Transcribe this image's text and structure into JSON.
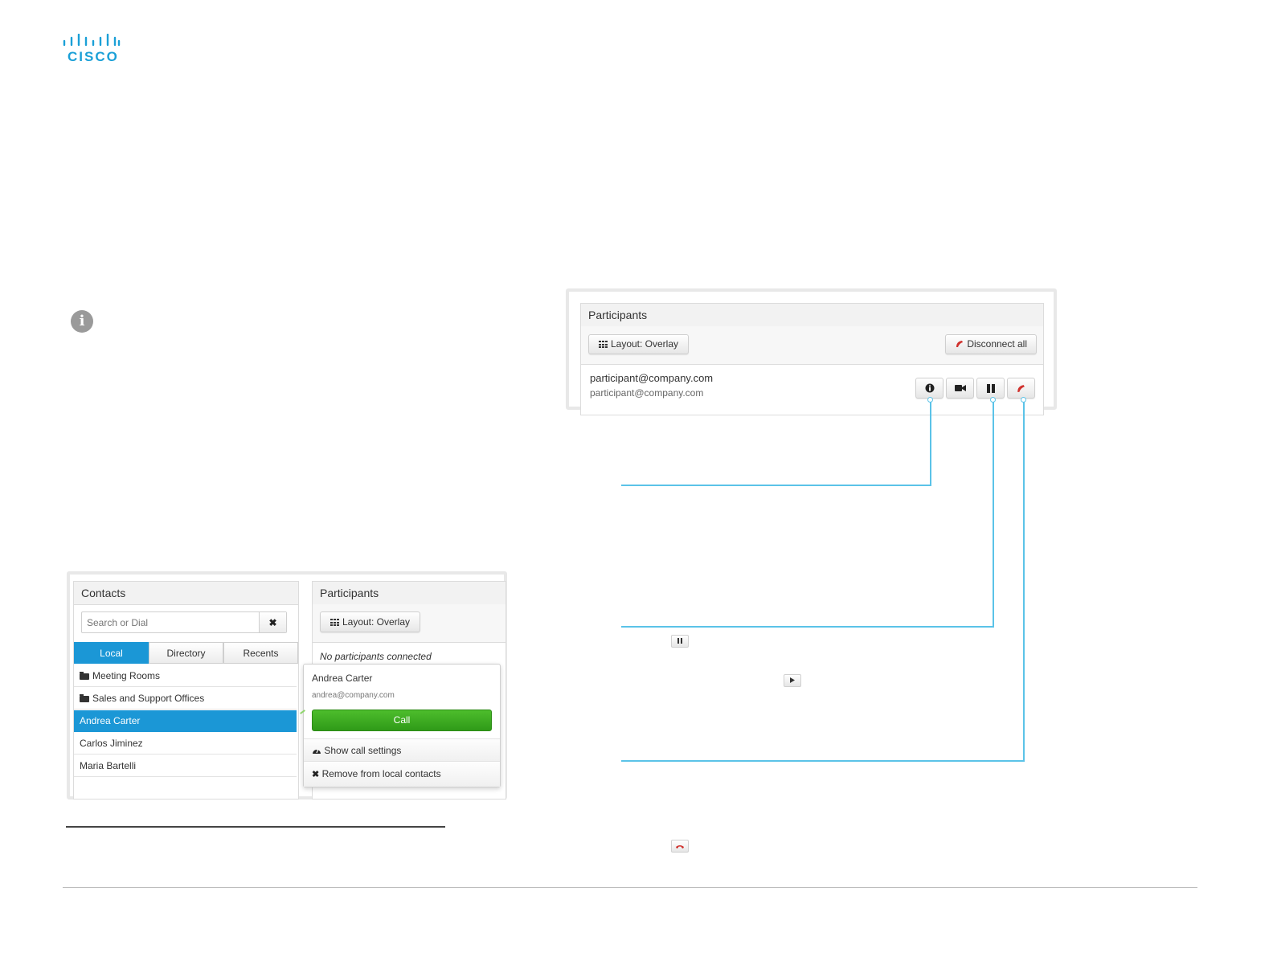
{
  "brand": {
    "logo_text": "CISCO"
  },
  "info_icon": "info-icon",
  "participants_panel": {
    "title": "Participants",
    "layout_button": "Layout: Overlay",
    "disconnect_all_button": "Disconnect all",
    "participant": {
      "name": "participant@company.com",
      "address": "participant@company.com",
      "actions": [
        "info-icon",
        "video-camera-icon",
        "pause-icon",
        "hang-up-icon"
      ]
    }
  },
  "contacts_panel": {
    "title": "Contacts",
    "search_placeholder": "Search or Dial",
    "clear_icon": "close-icon",
    "tabs": [
      {
        "label": "Local",
        "active": true
      },
      {
        "label": "Directory",
        "active": false
      },
      {
        "label": "Recents",
        "active": false
      }
    ],
    "items": [
      {
        "label": "Meeting Rooms",
        "folder": true
      },
      {
        "label": "Sales and Support Offices",
        "folder": true
      },
      {
        "label": "Andrea Carter",
        "selected": true
      },
      {
        "label": "Carlos Jiminez"
      },
      {
        "label": "Maria Bartelli"
      }
    ]
  },
  "participants_small": {
    "title": "Participants",
    "layout_button": "Layout: Overlay",
    "empty_text": "No participants connected"
  },
  "contact_popup": {
    "name": "Andrea Carter",
    "email": "andrea@company.com",
    "call_button": "Call",
    "show_settings": "Show call settings",
    "remove": "Remove from local contacts"
  },
  "inline_icons": [
    "pause-icon",
    "play-icon",
    "hang-up-icon"
  ],
  "colors": {
    "accent_blue": "#1b97d6",
    "call_green": "#3aa51f",
    "callout_line": "#5bc3e8",
    "hangup_red": "#d0312d",
    "cisco_blue": "#1ba0d7"
  }
}
